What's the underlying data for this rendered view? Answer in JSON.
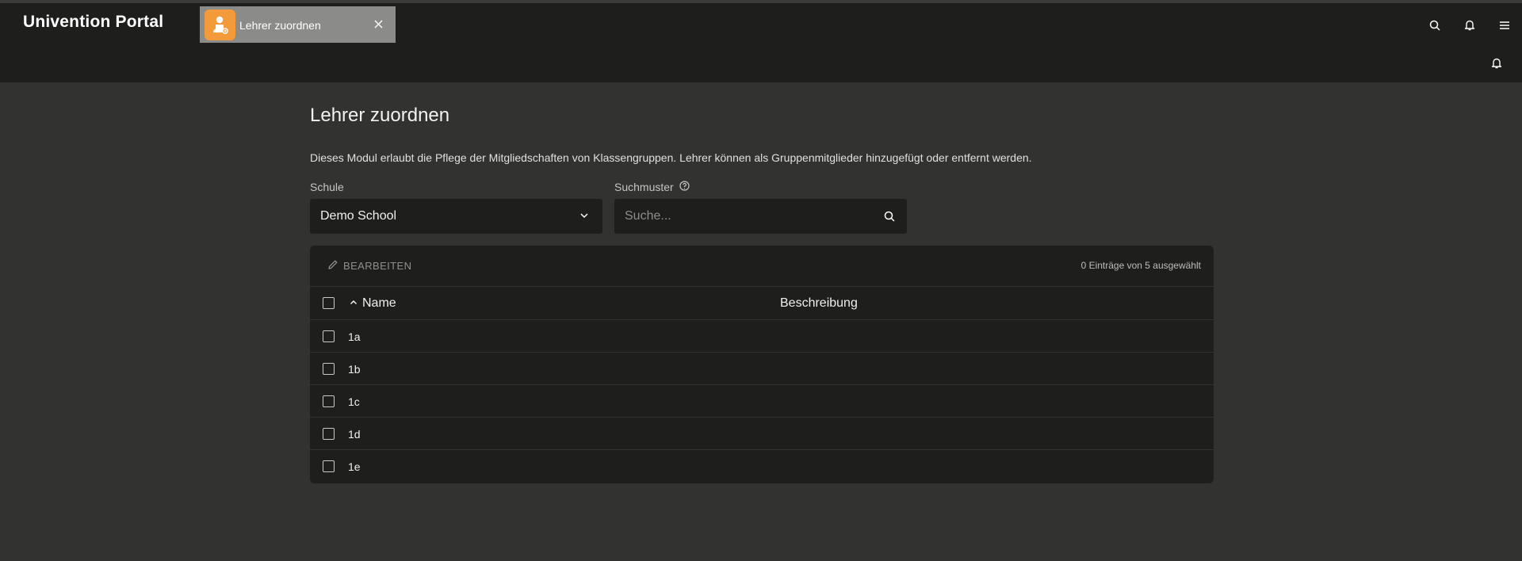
{
  "portal": {
    "title": "Univention Portal"
  },
  "tab": {
    "label": "Lehrer zuordnen",
    "icon": "teacher-assign-icon",
    "icon_color": "#f39a3b"
  },
  "top_icons": [
    "search-icon",
    "bell-icon",
    "menu-icon"
  ],
  "module": {
    "title": "Lehrer zuordnen",
    "description": "Dieses Modul erlaubt die Pflege der Mitgliedschaften von Klassengruppen. Lehrer können als Gruppenmitglieder hinzugefügt oder entfernt werden.",
    "school_label": "Schule",
    "school_value": "Demo School",
    "search_label": "Suchmuster",
    "search_placeholder": "Suche...",
    "search_value": ""
  },
  "grid": {
    "edit_label": "BEARBEITEN",
    "selection_status": "0 Einträge von 5 ausgewählt",
    "columns": {
      "name": "Name",
      "description": "Beschreibung"
    },
    "rows": [
      {
        "name": "1a",
        "description": ""
      },
      {
        "name": "1b",
        "description": ""
      },
      {
        "name": "1c",
        "description": ""
      },
      {
        "name": "1d",
        "description": ""
      },
      {
        "name": "1e",
        "description": ""
      }
    ]
  },
  "colors": {
    "background": "#323230",
    "bar": "#1e1e1d",
    "tab": "#8b8b89",
    "accent": "#f39a3b"
  }
}
